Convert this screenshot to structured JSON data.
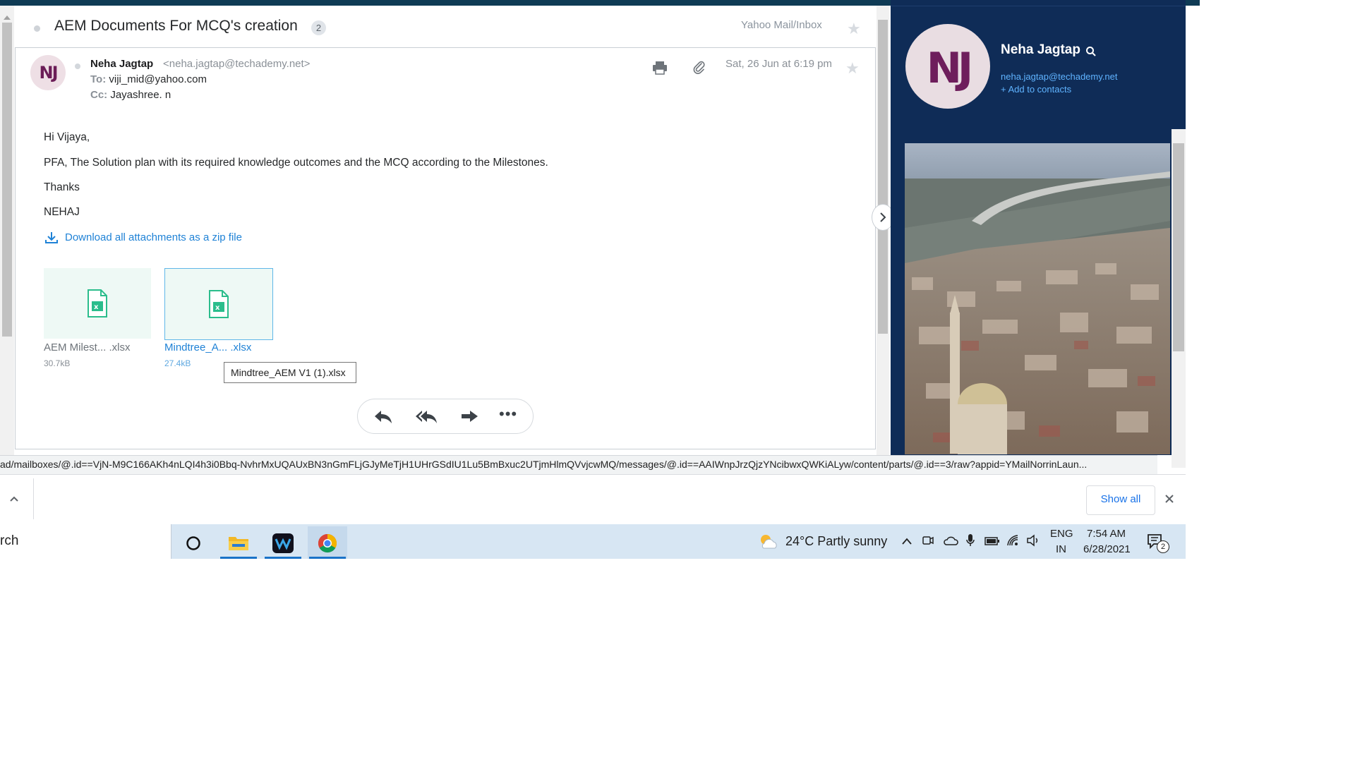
{
  "email": {
    "subject": "AEM Documents For MCQ's creation",
    "thread_count": "2",
    "folder_path": "Yahoo Mail/Inbox",
    "avatar_initials": "NJ",
    "sender_name": "Neha Jagtap",
    "sender_email": "<neha.jagtap@techademy.net>",
    "to_label": "To:",
    "to_value": "viji_mid@yahoo.com",
    "cc_label": "Cc:",
    "cc_value": "Jayashree. n",
    "date": "Sat, 26 Jun at 6:19 pm",
    "body": {
      "greeting": "Hi Vijaya,",
      "line1": "PFA, The Solution plan with its required knowledge outcomes and the MCQ according to the Milestones.",
      "line2": "Thanks",
      "signature": "NEHAJ"
    },
    "download_all_label": "Download all attachments as a zip file",
    "attachments": [
      {
        "name": "AEM Milest... .xlsx",
        "size": "30.7kB"
      },
      {
        "name": "Mindtree_A... .xlsx",
        "size": "27.4kB"
      }
    ],
    "tooltip": "Mindtree_AEM V1 (1).xlsx"
  },
  "contact": {
    "initials": "NJ",
    "name": "Neha Jagtap",
    "email": "neha.jagtap@techademy.net",
    "add_label": "+ Add to contacts"
  },
  "status_url": "ad/mailboxes/@.id==VjN-M9C166AKh4nLQI4h3i0Bbq-NvhrMxUQAUxBN3nGmFLjGJyMeTjH1UHrGSdIU1Lu5BmBxuc2UTjmHlmQVvjcwMQ/messages/@.id==AAIWnpJrzQjzYNcibwxQWKiALyw/content/parts/@.id==3/raw?appid=YMailNorrinLaun...",
  "shelf": {
    "show_all_label": "Show all"
  },
  "taskbar": {
    "search_text": "rch",
    "weather": "24°C  Partly sunny",
    "lang_top": "ENG",
    "lang_bottom": "IN",
    "time": "7:54 AM",
    "date": "6/28/2021",
    "notification_count": "2"
  },
  "colors": {
    "accent_blue": "#1f82d6",
    "contact_panel_bg": "#0f2c57",
    "excel_green": "#2bbd8c"
  }
}
